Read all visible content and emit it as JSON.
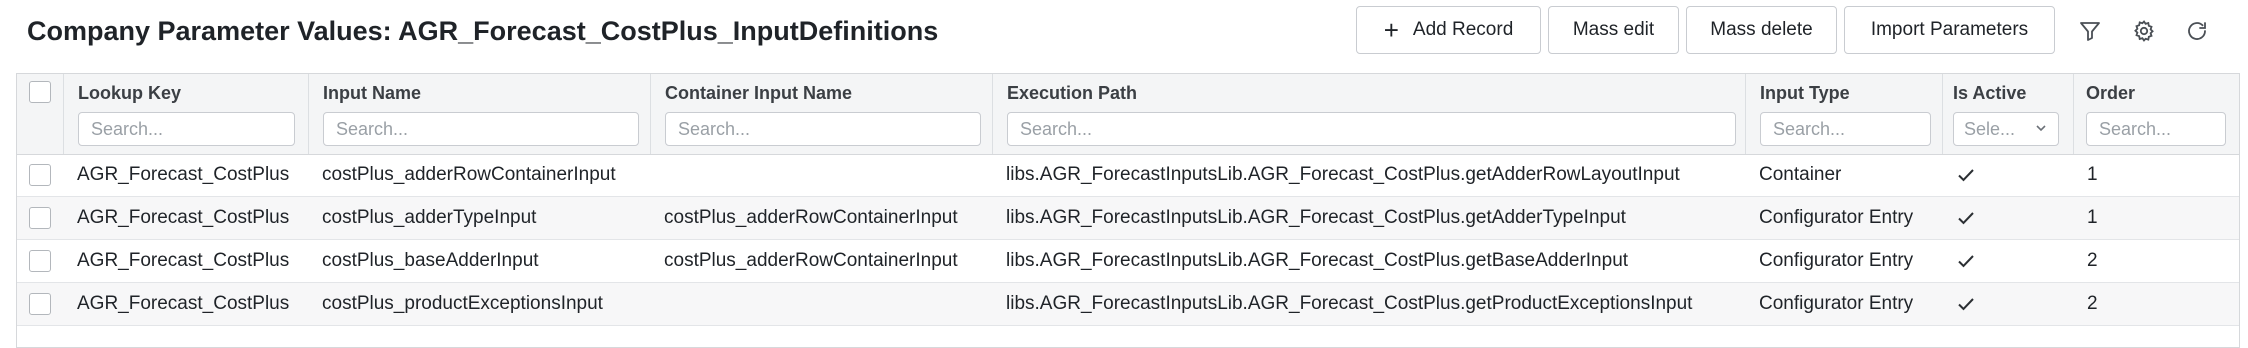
{
  "page": {
    "title": "Company Parameter Values: AGR_Forecast_CostPlus_InputDefinitions"
  },
  "toolbar": {
    "add_record": "Add Record",
    "mass_edit": "Mass edit",
    "mass_delete": "Mass delete",
    "import_parameters": "Import Parameters",
    "icons": [
      "filter-icon",
      "gear-icon",
      "refresh-icon"
    ]
  },
  "grid": {
    "columns": [
      {
        "label": "Lookup Key",
        "placeholder": "Search..."
      },
      {
        "label": "Input Name",
        "placeholder": "Search..."
      },
      {
        "label": "Container Input Name",
        "placeholder": "Search..."
      },
      {
        "label": "Execution Path",
        "placeholder": "Search..."
      },
      {
        "label": "Input Type",
        "placeholder": "Search..."
      },
      {
        "label": "Is Active",
        "placeholder": "Sele..."
      },
      {
        "label": "Order",
        "placeholder": "Search..."
      }
    ],
    "rows": [
      {
        "lookup_key": "AGR_Forecast_CostPlus",
        "input_name": "costPlus_adderRowContainerInput",
        "container_input_name": "",
        "execution_path": "libs.AGR_ForecastInputsLib.AGR_Forecast_CostPlus.getAdderRowLayoutInput",
        "input_type": "Container",
        "is_active": true,
        "order": "1"
      },
      {
        "lookup_key": "AGR_Forecast_CostPlus",
        "input_name": "costPlus_adderTypeInput",
        "container_input_name": "costPlus_adderRowContainerInput",
        "execution_path": "libs.AGR_ForecastInputsLib.AGR_Forecast_CostPlus.getAdderTypeInput",
        "input_type": "Configurator Entry",
        "is_active": true,
        "order": "1"
      },
      {
        "lookup_key": "AGR_Forecast_CostPlus",
        "input_name": "costPlus_baseAdderInput",
        "container_input_name": "costPlus_adderRowContainerInput",
        "execution_path": "libs.AGR_ForecastInputsLib.AGR_Forecast_CostPlus.getBaseAdderInput",
        "input_type": "Configurator Entry",
        "is_active": true,
        "order": "2"
      },
      {
        "lookup_key": "AGR_Forecast_CostPlus",
        "input_name": "costPlus_productExceptionsInput",
        "container_input_name": "",
        "execution_path": "libs.AGR_ForecastInputsLib.AGR_Forecast_CostPlus.getProductExceptionsInput",
        "input_type": "Configurator Entry",
        "is_active": true,
        "order": "2"
      }
    ]
  }
}
